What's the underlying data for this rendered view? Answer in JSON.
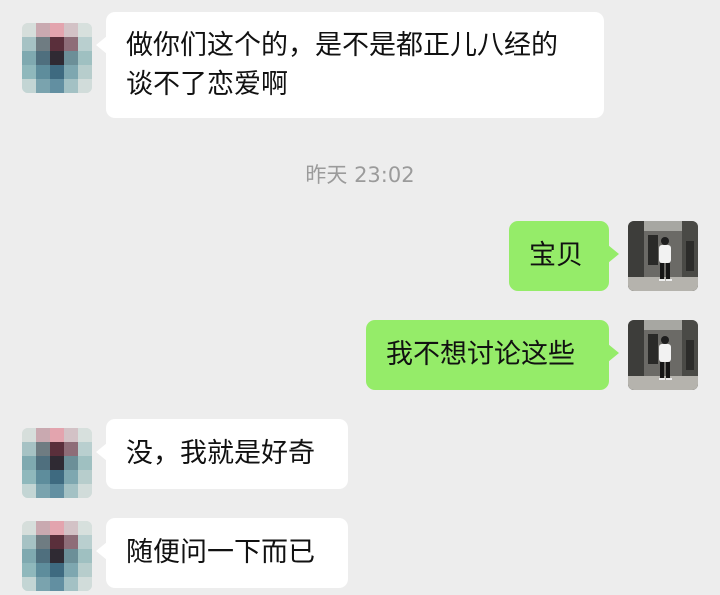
{
  "messages": [
    {
      "side": "in",
      "text": "做你们这个的，是不是都正儿八经的谈不了恋爱啊",
      "avatar_icon": "pixelated-avatar-icon"
    },
    {
      "side": "out",
      "text": "宝贝",
      "avatar_icon": "user-photo-avatar-icon"
    },
    {
      "side": "out",
      "text": "我不想讨论这些",
      "avatar_icon": "user-photo-avatar-icon"
    },
    {
      "side": "in",
      "text": "没，我就是好奇",
      "avatar_icon": "pixelated-avatar-icon"
    },
    {
      "side": "in",
      "text": "随便问一下而已",
      "avatar_icon": "pixelated-avatar-icon"
    }
  ],
  "timestamp": "昨天 23:02",
  "colors": {
    "background": "#ededed",
    "incoming_bubble": "#ffffff",
    "outgoing_bubble": "#95ec69",
    "timestamp_text": "#9b9b9b"
  }
}
